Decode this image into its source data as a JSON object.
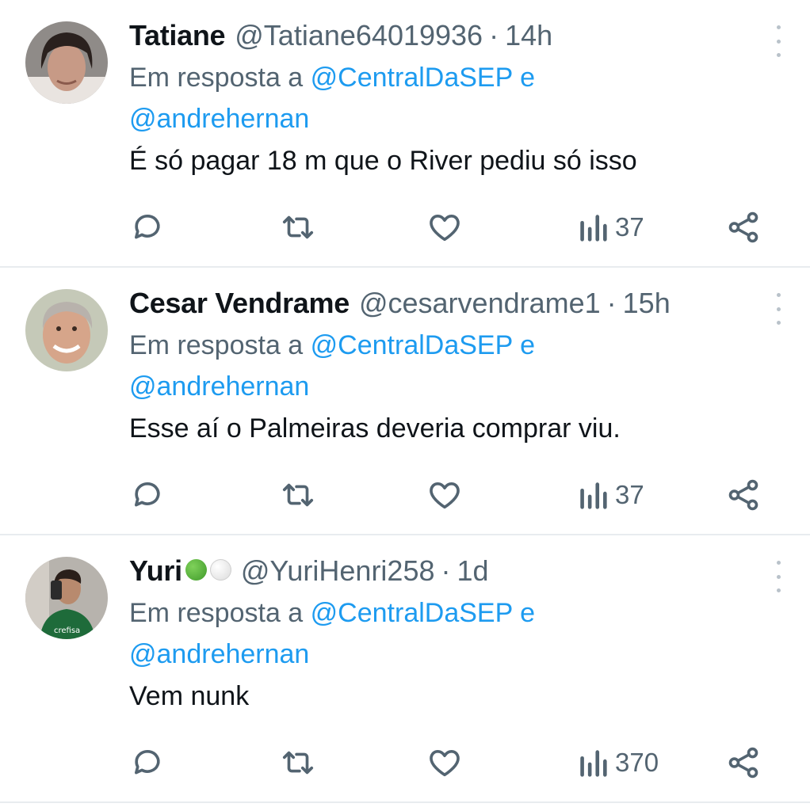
{
  "tweets": [
    {
      "name": "Tatiane",
      "handle": "@Tatiane64019936",
      "separator": "·",
      "time": "14h",
      "reply_prefix": "Em resposta a",
      "reply_mention1": "@CentralDaSEP",
      "reply_conj": "e",
      "reply_mention2": "@andrehernan",
      "text": "É só pagar 18 m que o River pediu só isso",
      "views": "37",
      "emoji": []
    },
    {
      "name": "Cesar Vendrame",
      "handle": "@cesarvendrame1",
      "separator": "·",
      "time": "15h",
      "reply_prefix": "Em resposta a",
      "reply_mention1": "@CentralDaSEP",
      "reply_conj": "e",
      "reply_mention2": "@andrehernan",
      "text": "Esse aí o Palmeiras deveria comprar viu.",
      "views": "37",
      "emoji": []
    },
    {
      "name": "Yuri",
      "handle": "@YuriHenri258",
      "separator": "·",
      "time": "1d",
      "reply_prefix": "Em resposta a",
      "reply_mention1": "@CentralDaSEP",
      "reply_conj": "e",
      "reply_mention2": "@andrehernan",
      "text": "Vem nunk",
      "views": "370",
      "emoji": [
        "green-circle",
        "white-circle"
      ]
    }
  ],
  "icons": {
    "reply": "reply-icon",
    "retweet": "retweet-icon",
    "like": "like-icon",
    "views": "views-icon",
    "share": "share-icon",
    "more": "more-icon"
  },
  "colors": {
    "mention": "#1d9bf0",
    "secondary_text": "#536471",
    "icon": "#536471",
    "divider": "#e8ecef",
    "green_emoji": "#5bb53b",
    "white_emoji": "#e7e7e7"
  }
}
